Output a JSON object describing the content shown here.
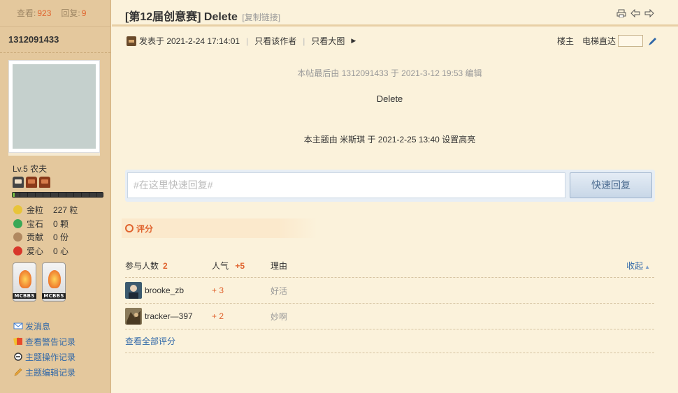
{
  "sidebar": {
    "views_label": "查看:",
    "views": "923",
    "replies_label": "回复:",
    "replies": "9",
    "username": "1312091433",
    "level": "Lv.5 农夫",
    "stats": [
      {
        "label": "金粒",
        "value": "227 粒",
        "icon": "gold-icon",
        "color": "#e8c43a"
      },
      {
        "label": "宝石",
        "value": "0 颗",
        "icon": "gem-icon",
        "color": "#3aa856"
      },
      {
        "label": "贡献",
        "value": "0 份",
        "icon": "contribution-icon",
        "color": "#b08860"
      },
      {
        "label": "爱心",
        "value": "0 心",
        "icon": "heart-icon",
        "color": "#d8362a"
      }
    ],
    "medals": [
      "MCBBS",
      "MCBBS"
    ],
    "links": [
      {
        "label": "发消息",
        "icon": "mail-icon",
        "color": "#3b7bd1"
      },
      {
        "label": "查看警告记录",
        "icon": "warning-card-icon",
        "color": "#e84a2a"
      },
      {
        "label": "主题操作记录",
        "icon": "minus-circle-icon",
        "color": "#333"
      },
      {
        "label": "主题编辑记录",
        "icon": "pencil-icon",
        "color": "#e8a43a"
      }
    ]
  },
  "thread": {
    "title": "[第12届创意赛] Delete",
    "copy_link": "[复制链接]"
  },
  "meta": {
    "posted": "发表于 2021-2-24 17:14:01",
    "only_author": "只看该作者",
    "big_image": "只看大图",
    "floor": "楼主",
    "goto_label": "电梯直达"
  },
  "post": {
    "edited_note": "本帖最后由 1312091433 于 2021-3-12 19:53 编辑",
    "body": "Delete",
    "highlight_note": "本主题由 米斯琪 于 2021-2-25 13:40 设置高亮"
  },
  "reply": {
    "placeholder": "#在这里快速回复#",
    "button": "快速回复"
  },
  "rating": {
    "section_label": "评分",
    "participants_label": "参与人数",
    "participants": "2",
    "popularity_label": "人气",
    "popularity_total": "+5",
    "reason_label": "理由",
    "collapse": "收起",
    "rows": [
      {
        "user": "brooke_zb",
        "score": "+ 3",
        "reason": "好活"
      },
      {
        "user": "tracker—397",
        "score": "+ 2",
        "reason": "妙啊"
      }
    ],
    "view_all": "查看全部评分"
  },
  "colors": {
    "accent": "#e0632e",
    "link": "#2f67a8",
    "sidebar_bg": "#e4c89d",
    "page_bg": "#fbf2db"
  }
}
